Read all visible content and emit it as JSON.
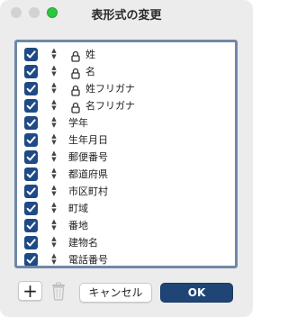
{
  "window": {
    "title": "表形式の変更",
    "accent_color": "#1f4a86",
    "traffic_lights": [
      "close",
      "minimize",
      "zoom"
    ]
  },
  "fields": [
    {
      "label": "姓",
      "checked": true,
      "locked": true
    },
    {
      "label": "名",
      "checked": true,
      "locked": true
    },
    {
      "label": "姓フリガナ",
      "checked": true,
      "locked": true
    },
    {
      "label": "名フリガナ",
      "checked": true,
      "locked": true
    },
    {
      "label": "学年",
      "checked": true,
      "locked": false
    },
    {
      "label": "生年月日",
      "checked": true,
      "locked": false
    },
    {
      "label": "郵便番号",
      "checked": true,
      "locked": false
    },
    {
      "label": "都道府県",
      "checked": true,
      "locked": false
    },
    {
      "label": "市区町村",
      "checked": true,
      "locked": false
    },
    {
      "label": "町域",
      "checked": true,
      "locked": false
    },
    {
      "label": "番地",
      "checked": true,
      "locked": false
    },
    {
      "label": "建物名",
      "checked": true,
      "locked": false
    },
    {
      "label": "電話番号",
      "checked": true,
      "locked": false
    }
  ],
  "footer": {
    "add_label": "+",
    "cancel_label": "キャンセル",
    "ok_label": "OK"
  }
}
